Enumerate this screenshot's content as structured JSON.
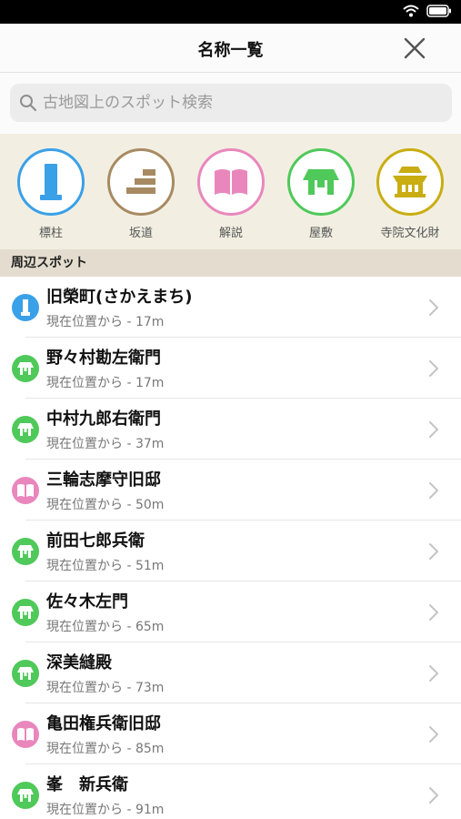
{
  "header": {
    "title": "名称一覧"
  },
  "search": {
    "placeholder": "古地図上のスポット検索"
  },
  "categories": [
    {
      "label": "標柱",
      "icon": "pillar-icon",
      "color": "#3aa0e8"
    },
    {
      "label": "坂道",
      "icon": "slope-stairs-icon",
      "color": "#a88a62"
    },
    {
      "label": "解説",
      "icon": "open-book-icon",
      "color": "#e987bd"
    },
    {
      "label": "屋敷",
      "icon": "house-icon",
      "color": "#4fc95a"
    },
    {
      "label": "寺院文化財",
      "icon": "temple-icon",
      "color": "#c9ad12"
    }
  ],
  "section": {
    "title": "周辺スポット"
  },
  "spots": [
    {
      "name": "旧榮町(さかえまち)",
      "distance": "現在位置から - 17m",
      "category": "pillar"
    },
    {
      "name": "野々村勘左衛門",
      "distance": "現在位置から - 17m",
      "category": "house"
    },
    {
      "name": "中村九郎右衛門",
      "distance": "現在位置から - 37m",
      "category": "house"
    },
    {
      "name": "三輪志摩守旧邸",
      "distance": "現在位置から - 50m",
      "category": "book"
    },
    {
      "name": "前田七郎兵衛",
      "distance": "現在位置から - 51m",
      "category": "house"
    },
    {
      "name": "佐々木左門",
      "distance": "現在位置から - 65m",
      "category": "house"
    },
    {
      "name": "深美縫殿",
      "distance": "現在位置から - 73m",
      "category": "house"
    },
    {
      "name": "亀田権兵衛旧邸",
      "distance": "現在位置から - 85m",
      "category": "book"
    },
    {
      "name": "峯　新兵衛",
      "distance": "現在位置から - 91m",
      "category": "house"
    }
  ]
}
